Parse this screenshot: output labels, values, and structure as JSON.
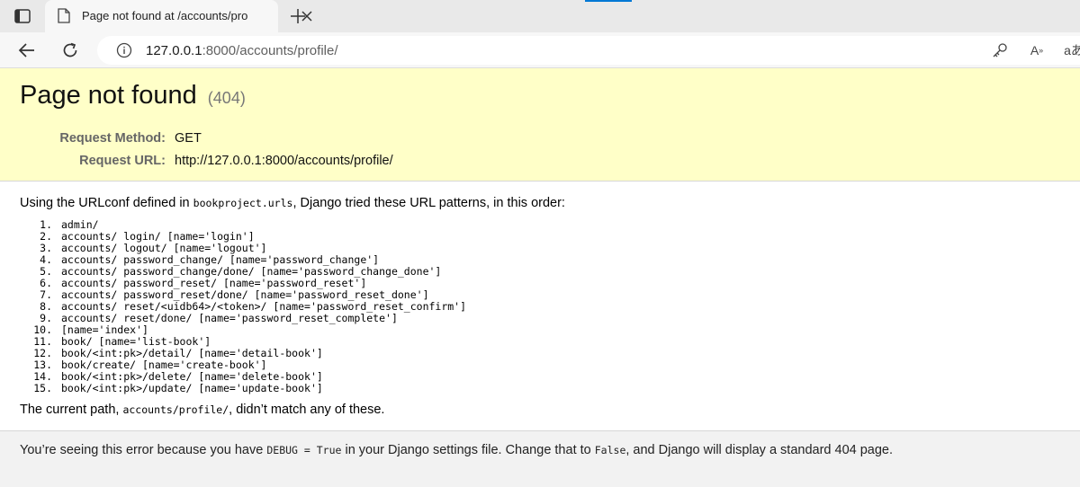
{
  "browser": {
    "tab_title": "Page not found at /accounts/pro",
    "url_host": "127.0.0.1",
    "url_rest": ":8000/accounts/profile/",
    "read_aloud_label": "A",
    "read_aloud_sup": "»",
    "translate_label": "aあ"
  },
  "summary": {
    "title": "Page not found",
    "status_code": "(404)",
    "request_method_label": "Request Method:",
    "request_method": "GET",
    "request_url_label": "Request URL:",
    "request_url": "http://127.0.0.1:8000/accounts/profile/"
  },
  "info": {
    "intro_prefix": "Using the URLconf defined in ",
    "urlconf": "bookproject.urls",
    "intro_suffix": ", Django tried these URL patterns, in this order:",
    "patterns": [
      {
        "n": "1.",
        "text": "admin/"
      },
      {
        "n": "2.",
        "text": "accounts/ login/ [name='login']"
      },
      {
        "n": "3.",
        "text": "accounts/ logout/ [name='logout']"
      },
      {
        "n": "4.",
        "text": "accounts/ password_change/ [name='password_change']"
      },
      {
        "n": "5.",
        "text": "accounts/ password_change/done/ [name='password_change_done']"
      },
      {
        "n": "6.",
        "text": "accounts/ password_reset/ [name='password_reset']"
      },
      {
        "n": "7.",
        "text": "accounts/ password_reset/done/ [name='password_reset_done']"
      },
      {
        "n": "8.",
        "text": "accounts/ reset/<uidb64>/<token>/ [name='password_reset_confirm']"
      },
      {
        "n": "9.",
        "text": "accounts/ reset/done/ [name='password_reset_complete']"
      },
      {
        "n": "10.",
        "text": "[name='index']"
      },
      {
        "n": "11.",
        "text": "book/ [name='list-book']"
      },
      {
        "n": "12.",
        "text": "book/<int:pk>/detail/ [name='detail-book']"
      },
      {
        "n": "13.",
        "text": "book/create/ [name='create-book']"
      },
      {
        "n": "14.",
        "text": "book/<int:pk>/delete/ [name='delete-book']"
      },
      {
        "n": "15.",
        "text": "book/<int:pk>/update/ [name='update-book']"
      }
    ],
    "current_prefix": "The current path, ",
    "current_path": "accounts/profile/",
    "current_suffix": ", didn’t match any of these."
  },
  "explanation": {
    "part1": "You’re seeing this error because you have ",
    "debug_code": "DEBUG = True",
    "part2": " in your Django settings file. Change that to ",
    "false_code": "False",
    "part3": ", and Django will display a standard 404 page."
  }
}
